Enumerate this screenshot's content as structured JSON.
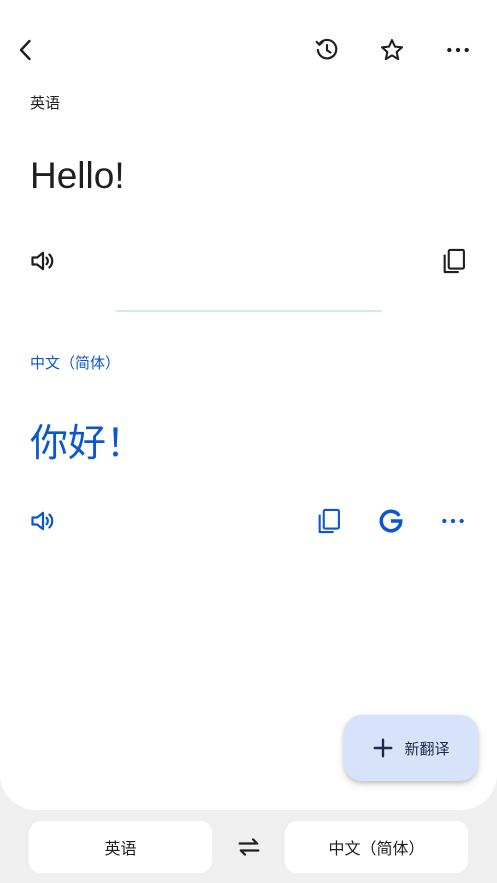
{
  "source": {
    "language": "英语",
    "text": "Hello!"
  },
  "target": {
    "language": "中文（简体）",
    "text": "你好！"
  },
  "fab": {
    "label": "新翻译"
  },
  "bottom_bar": {
    "source_language": "英语",
    "target_language": "中文（简体）"
  },
  "colors": {
    "accent": "#0b57d0",
    "fab_bg": "#d6e3fb",
    "divider": "#cfeaf0"
  },
  "icons": [
    "back-icon",
    "history-icon",
    "star-icon",
    "more-icon",
    "speaker-icon",
    "copy-icon",
    "google-icon",
    "swap-icon",
    "plus-icon"
  ]
}
